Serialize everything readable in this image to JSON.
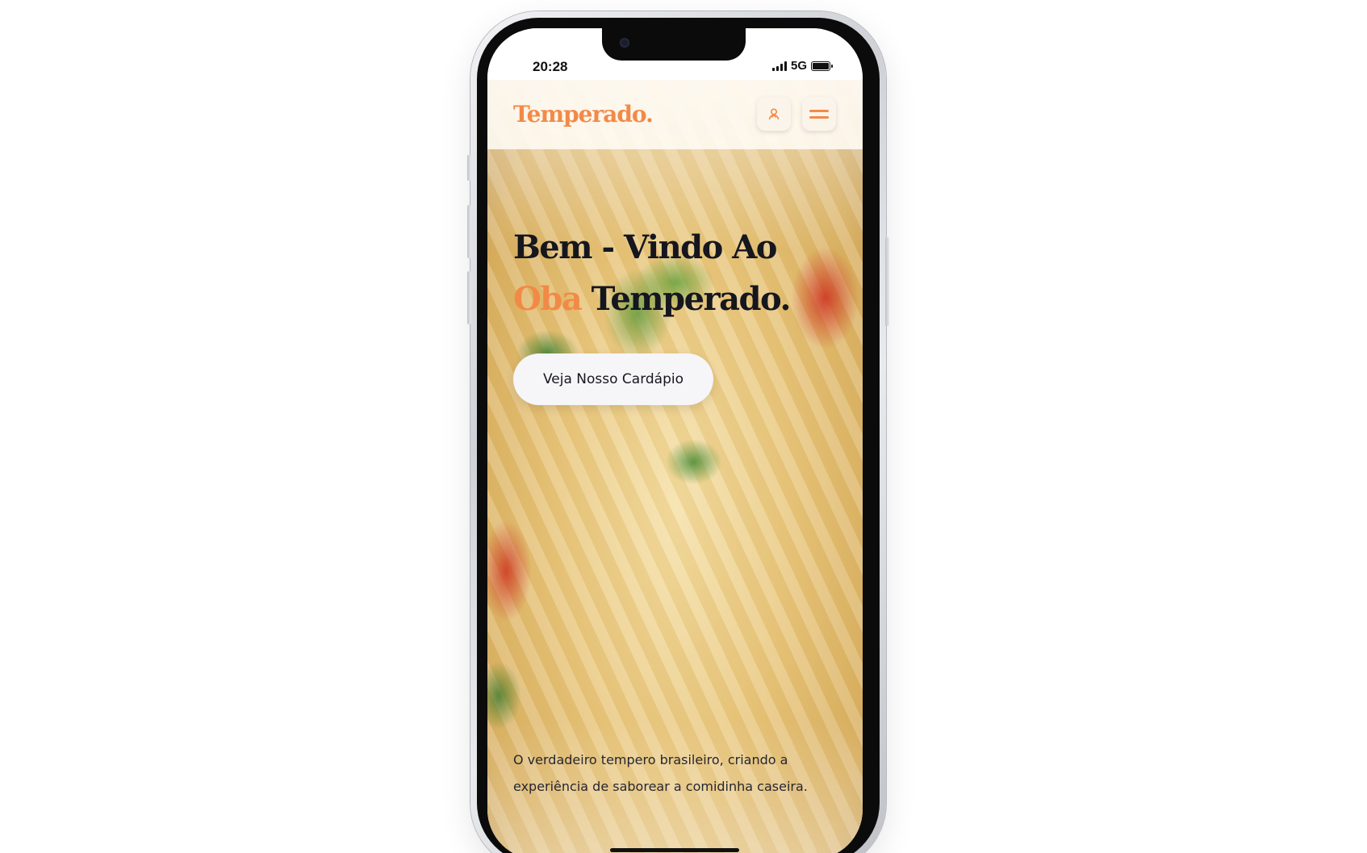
{
  "status_bar": {
    "time": "20:28",
    "network": "5G",
    "signal_bars": 4,
    "battery_level": 1.0
  },
  "header": {
    "logo": "Temperado.",
    "user_icon": "user-icon",
    "menu_icon": "hamburger-menu-icon"
  },
  "hero": {
    "headline_line1": "Bem - Vindo Ao",
    "headline_accent": "Oba",
    "headline_line2_rest": " Temperado.",
    "cta_label": "Veja Nosso Cardápio",
    "tagline": "O verdadeiro tempero brasileiro, criando a experiência de saborear a comidinha caseira.",
    "background_image": "pasta-dish-photo"
  },
  "colors": {
    "accent": "#f28a47",
    "text_dark": "#15161e",
    "button_bg": "#f6f5f8"
  }
}
